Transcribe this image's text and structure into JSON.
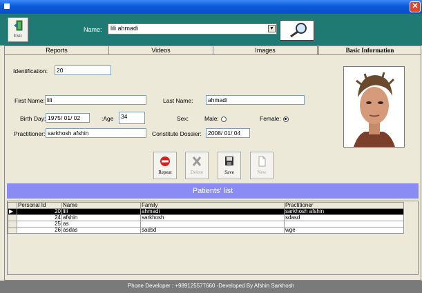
{
  "window": {
    "close_glyph": "✕"
  },
  "toolbar": {
    "exit_label": "Exit",
    "name_label": "Name:",
    "name_value": "lili ahmadi",
    "search_icon": "magnifier-icon"
  },
  "tabs": [
    {
      "label": "Reports"
    },
    {
      "label": "Videos"
    },
    {
      "label": "Images"
    },
    {
      "label": "Basic Information",
      "active": true
    }
  ],
  "form": {
    "identification_label": "Identification:",
    "identification_value": "20",
    "first_name_label": "First Name:",
    "first_name_value": "lili",
    "last_name_label": "Last Name:",
    "last_name_value": "ahmadi",
    "birthday_label": "Birth Day:",
    "birthday_value": "1975/  01/  02",
    "age_label": ":Age",
    "age_value": "34",
    "sex_label": "Sex:",
    "male_label": "Male:",
    "female_label": "Female:",
    "sex_selected": "Female",
    "practitioner_label": "Practitioner:",
    "practitioner_value": "sarkhosh afshin",
    "dossier_label": "Constitute Dossier:",
    "dossier_value": "2008/  01/  04"
  },
  "actions": {
    "repeat": "Repeat",
    "delete": "Delete",
    "save": "Save",
    "new": "New"
  },
  "patients": {
    "title": "Patients' list",
    "columns": [
      "Personal Id",
      "Name",
      "Family",
      "Practitioner"
    ],
    "rows": [
      {
        "id": "20",
        "name": "lili",
        "family": "ahmadi",
        "practitioner": "sarkhosh afshin",
        "selected": true
      },
      {
        "id": "24",
        "name": "afshin",
        "family": "sarkhosh",
        "practitioner": "sdasd"
      },
      {
        "id": "25",
        "name": "as",
        "family": "",
        "practitioner": ""
      },
      {
        "id": "26",
        "name": "asdas",
        "family": "sadsd",
        "practitioner": "wge"
      }
    ]
  },
  "status": {
    "text": "Phone Developer : +989125577660 -Developed By Afshin Sarkhosh"
  },
  "colors": {
    "toolbar": "#1e7a72",
    "list_header": "#8b8bf5",
    "status_bar": "#7a7a7a"
  }
}
